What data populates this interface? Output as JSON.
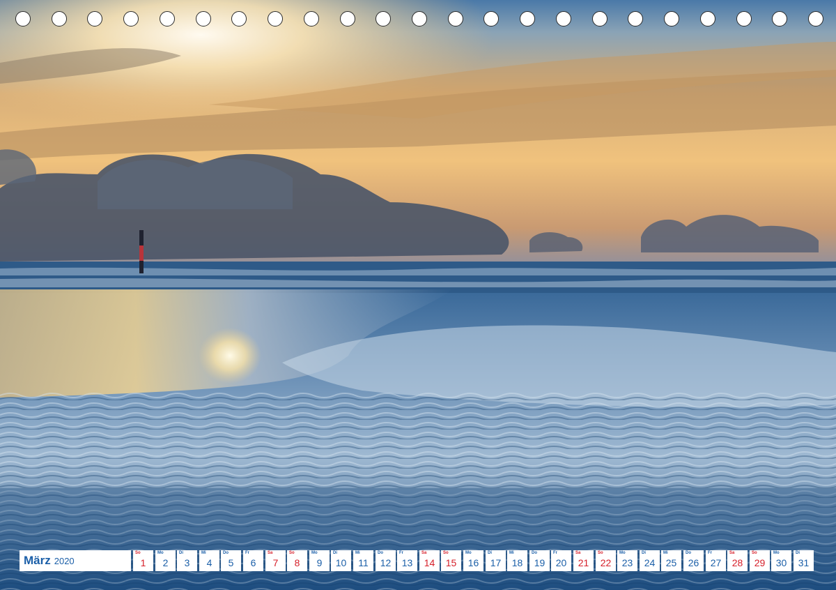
{
  "binding_holes": 23,
  "calendar": {
    "month": "März",
    "year": "2020",
    "days": [
      {
        "wd": "So",
        "num": "1",
        "weekend": true
      },
      {
        "wd": "Mo",
        "num": "2",
        "weekend": false
      },
      {
        "wd": "Di",
        "num": "3",
        "weekend": false
      },
      {
        "wd": "Mi",
        "num": "4",
        "weekend": false
      },
      {
        "wd": "Do",
        "num": "5",
        "weekend": false
      },
      {
        "wd": "Fr",
        "num": "6",
        "weekend": false
      },
      {
        "wd": "Sa",
        "num": "7",
        "weekend": true
      },
      {
        "wd": "So",
        "num": "8",
        "weekend": true
      },
      {
        "wd": "Mo",
        "num": "9",
        "weekend": false
      },
      {
        "wd": "Di",
        "num": "10",
        "weekend": false
      },
      {
        "wd": "Mi",
        "num": "11",
        "weekend": false
      },
      {
        "wd": "Do",
        "num": "12",
        "weekend": false
      },
      {
        "wd": "Fr",
        "num": "13",
        "weekend": false
      },
      {
        "wd": "Sa",
        "num": "14",
        "weekend": true
      },
      {
        "wd": "So",
        "num": "15",
        "weekend": true
      },
      {
        "wd": "Mo",
        "num": "16",
        "weekend": false
      },
      {
        "wd": "Di",
        "num": "17",
        "weekend": false
      },
      {
        "wd": "Mi",
        "num": "18",
        "weekend": false
      },
      {
        "wd": "Do",
        "num": "19",
        "weekend": false
      },
      {
        "wd": "Fr",
        "num": "20",
        "weekend": false
      },
      {
        "wd": "Sa",
        "num": "21",
        "weekend": true
      },
      {
        "wd": "So",
        "num": "22",
        "weekend": true
      },
      {
        "wd": "Mo",
        "num": "23",
        "weekend": false
      },
      {
        "wd": "Di",
        "num": "24",
        "weekend": false
      },
      {
        "wd": "Mi",
        "num": "25",
        "weekend": false
      },
      {
        "wd": "Do",
        "num": "26",
        "weekend": false
      },
      {
        "wd": "Fr",
        "num": "27",
        "weekend": false
      },
      {
        "wd": "Sa",
        "num": "28",
        "weekend": true
      },
      {
        "wd": "So",
        "num": "29",
        "weekend": true
      },
      {
        "wd": "Mo",
        "num": "30",
        "weekend": false
      },
      {
        "wd": "Di",
        "num": "31",
        "weekend": false
      }
    ]
  },
  "colors": {
    "weekday_text": "#1b5fa8",
    "weekend_text": "#d6202a",
    "sky_top": "#3f6d9c",
    "sunset_gold": "#e8b46a",
    "sea": "#2f5f8f"
  }
}
